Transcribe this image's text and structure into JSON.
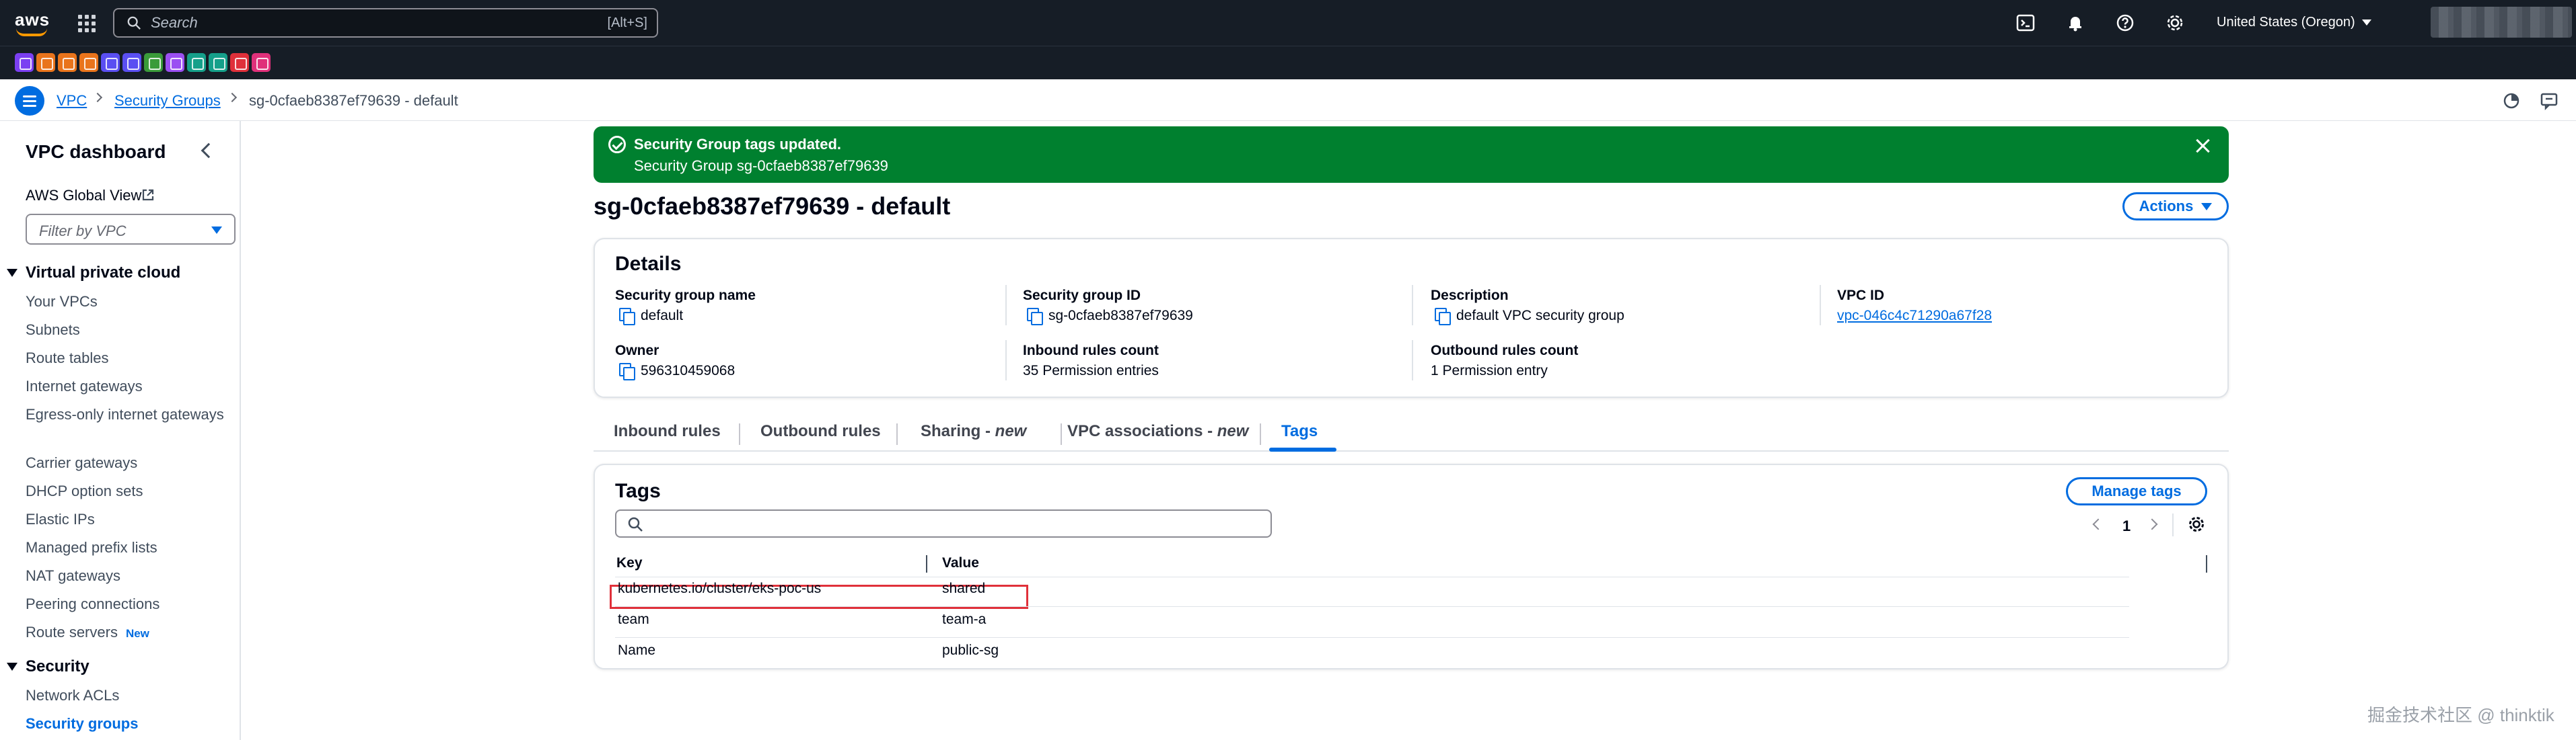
{
  "topnav": {
    "logo_text": "aws",
    "search": {
      "placeholder": "Search",
      "shortcut": "[Alt+S]"
    },
    "region": "United States (Oregon)",
    "icons": [
      "cloudshell-icon",
      "bell-icon",
      "help-icon",
      "gear-icon"
    ]
  },
  "favorites": [
    {
      "name": "service-1",
      "color": "#7b3ff2"
    },
    {
      "name": "service-2",
      "color": "#e9741b"
    },
    {
      "name": "service-3",
      "color": "#e9741b"
    },
    {
      "name": "service-4",
      "color": "#e9741b"
    },
    {
      "name": "service-5",
      "color": "#5a4ff2"
    },
    {
      "name": "service-6",
      "color": "#5a4ff2"
    },
    {
      "name": "service-7",
      "color": "#3a9b3a"
    },
    {
      "name": "service-8",
      "color": "#9b4ff2"
    },
    {
      "name": "service-9",
      "color": "#15a08a"
    },
    {
      "name": "service-10",
      "color": "#15a08a"
    },
    {
      "name": "service-11",
      "color": "#e0303a"
    },
    {
      "name": "service-12",
      "color": "#e0307a"
    }
  ],
  "breadcrumb": {
    "items": [
      "VPC",
      "Security Groups"
    ],
    "current": "sg-0cfaeb8387ef79639 - default"
  },
  "sidebar": {
    "title": "VPC dashboard",
    "global_view": "AWS Global View",
    "filter_placeholder": "Filter by VPC",
    "sections": [
      {
        "title": "Virtual private cloud",
        "items": [
          "Your VPCs",
          "Subnets",
          "Route tables",
          "Internet gateways",
          "Egress-only internet gateways",
          "Carrier gateways",
          "DHCP option sets",
          "Elastic IPs",
          "Managed prefix lists",
          "NAT gateways",
          "Peering connections",
          "Route servers"
        ]
      },
      {
        "title": "Security",
        "items": [
          "Network ACLs",
          "Security groups"
        ]
      }
    ],
    "new_badge": "New"
  },
  "flash": {
    "title": "Security Group tags updated.",
    "message": "Security Group sg-0cfaeb8387ef79639"
  },
  "page": {
    "title": "sg-0cfaeb8387ef79639 - default",
    "actions_label": "Actions"
  },
  "details": {
    "title": "Details",
    "fields": {
      "sg_name": {
        "label": "Security group name",
        "value": "default"
      },
      "sg_id": {
        "label": "Security group ID",
        "value": "sg-0cfaeb8387ef79639"
      },
      "description": {
        "label": "Description",
        "value": "default VPC security group"
      },
      "vpc_id": {
        "label": "VPC ID",
        "value": "vpc-046c4c71290a67f28"
      },
      "owner": {
        "label": "Owner",
        "value": "596310459068"
      },
      "inbound": {
        "label": "Inbound rules count",
        "value": "35 Permission entries"
      },
      "outbound": {
        "label": "Outbound rules count",
        "value": "1 Permission entry"
      }
    }
  },
  "tabs": [
    {
      "label": "Inbound rules",
      "suffix": ""
    },
    {
      "label": "Outbound rules",
      "suffix": ""
    },
    {
      "label": "Sharing - ",
      "suffix": "new"
    },
    {
      "label": "VPC associations - ",
      "suffix": "new"
    },
    {
      "label": "Tags",
      "suffix": ""
    }
  ],
  "active_tab": "Tags",
  "tags": {
    "title": "Tags",
    "manage_label": "Manage tags",
    "search_value": "",
    "page_number": "1",
    "columns": [
      "Key",
      "Value"
    ],
    "rows": [
      {
        "key": "kubernetes.io/cluster/eks-poc-us",
        "value": "shared"
      },
      {
        "key": "team",
        "value": "team-a"
      },
      {
        "key": "Name",
        "value": "public-sg"
      }
    ]
  },
  "watermark": "掘金技术社区 @ thinktik",
  "colors": {
    "nav_bg": "#161d26",
    "accent": "#006ce0",
    "success": "#00802f",
    "highlight": "#e0303a"
  }
}
